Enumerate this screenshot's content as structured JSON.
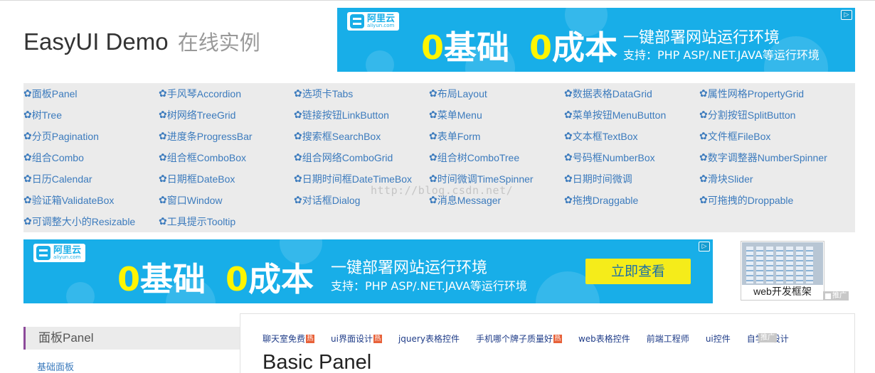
{
  "header": {
    "title": "EasyUI Demo",
    "subtitle": "在线实例"
  },
  "ad_banner": {
    "logo_cn": "阿里云",
    "logo_en": "aliyun.com",
    "zero1": "0",
    "word1": "基础",
    "zero2": "0",
    "word2": "成本",
    "tagline": "一键部署网站运行环境",
    "support": "支持：PHP ASP/.NET.JAVA等运行环境",
    "cta": "立即查看",
    "badge": "▷"
  },
  "nav": {
    "icon": "gear-icon",
    "watermark": "http://blog.csdn.net/",
    "items": [
      "面板Panel",
      "手风琴Accordion",
      "选项卡Tabs",
      "布局Layout",
      "数据表格DataGrid",
      "属性网格PropertyGrid",
      "树Tree",
      "树网络TreeGrid",
      "链接按钮LinkButton",
      "菜单Menu",
      "菜单按钮MenuButton",
      "分割按钮SplitButton",
      "分页Pagination",
      "进度条ProgressBar",
      "搜索框SearchBox",
      "表单Form",
      "文本框TextBox",
      "文件框FileBox",
      "组合Combo",
      "组合框ComboBox",
      "组合网络ComboGrid",
      "组合树ComboTree",
      "号码框NumberBox",
      "数字调整器NumberSpinner",
      "日历Calendar",
      "日期框DateBox",
      "日期时间框DateTimeBox",
      "时间微调TimeSpinner",
      "日期时间微调",
      "滑块Slider",
      "验证箱ValidateBox",
      "窗口Window",
      "对话框Dialog",
      "消息Messager",
      "拖拽Draggable",
      "可拖拽的Droppable",
      "可调整大小的Resizable",
      "工具提示Tooltip"
    ]
  },
  "side_ad": {
    "caption": "web开发框架",
    "promo": "推广"
  },
  "sidebar": {
    "heading": "面板Panel",
    "link": "基础面板"
  },
  "content": {
    "hot_label": "热",
    "links": [
      {
        "text": "聊天室免费",
        "hot": true
      },
      {
        "text": "ui界面设计",
        "hot": true
      },
      {
        "text": "jquery表格控件",
        "hot": false
      },
      {
        "text": "手机哪个牌子质量好",
        "hot": true
      },
      {
        "text": "web表格控件",
        "hot": false
      },
      {
        "text": "前端工程师",
        "hot": false
      },
      {
        "text": "ui控件",
        "hot": false
      },
      {
        "text": "自学ui设计",
        "hot": false
      }
    ],
    "promo": "推广",
    "title": "Basic Panel"
  },
  "colors": {
    "accent_blue": "#18aee8",
    "link_blue": "#3c7bbd",
    "highlight_yellow": "#fff500",
    "sidebar_marker": "#8c4a9a"
  }
}
